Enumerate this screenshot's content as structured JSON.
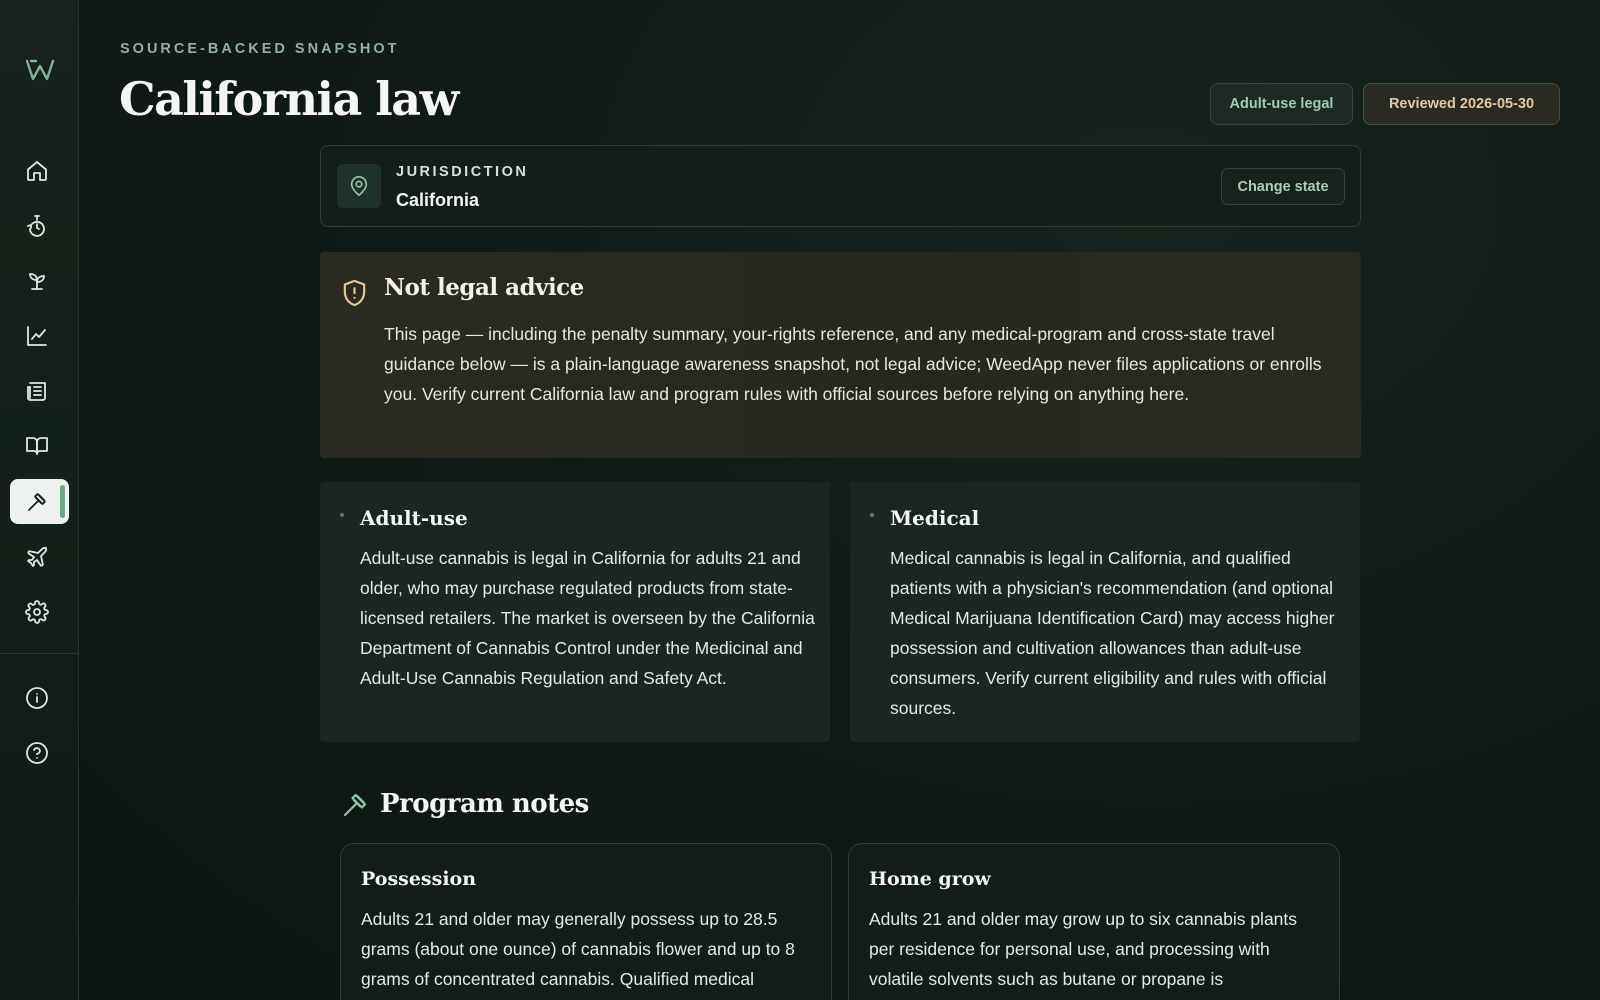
{
  "header": {
    "eyebrow": "SOURCE-BACKED SNAPSHOT",
    "title": "California law",
    "badges": {
      "status": "Adult-use legal",
      "reviewed": "Reviewed 2026-05-30"
    }
  },
  "sidebar": {
    "logo_icon": "weedapp-logo-icon",
    "items": [
      {
        "icon": "home-icon"
      },
      {
        "icon": "session-timer-icon"
      },
      {
        "icon": "sprout-icon"
      },
      {
        "icon": "chart-line-icon"
      },
      {
        "icon": "newspaper-icon"
      },
      {
        "icon": "book-open-icon"
      },
      {
        "icon": "gavel-icon",
        "active": true
      },
      {
        "icon": "plane-icon"
      },
      {
        "icon": "gear-icon"
      }
    ],
    "footer_items": [
      {
        "icon": "info-icon"
      },
      {
        "icon": "help-icon"
      }
    ]
  },
  "jurisdiction": {
    "label": "JURISDICTION",
    "value": "California",
    "change_label": "Change state",
    "icon": "map-pin-icon"
  },
  "disclaimer": {
    "icon": "shield-alert-icon",
    "title": "Not legal advice",
    "text": "This page — including the penalty summary, your-rights reference, and any medical-program and cross-state travel guidance below — is a plain-language awareness snapshot, not legal advice; WeedApp never files applications or enrolls you. Verify current California law and program rules with official sources before relying on anything here."
  },
  "status_cards": [
    {
      "title": "Adult-use",
      "text": "Adult-use cannabis is legal in California for adults 21 and older, who may purchase regulated products from state-licensed retailers. The market is overseen by the California Department of Cannabis Control under the Medicinal and Adult-Use Cannabis Regulation and Safety Act."
    },
    {
      "title": "Medical",
      "text": "Medical cannabis is legal in California, and qualified patients with a physician's recommendation (and optional Medical Marijuana Identification Card) may access higher possession and cultivation allowances than adult-use consumers. Verify current eligibility and rules with official sources."
    }
  ],
  "program_notes": {
    "title": "Program notes",
    "icon": "gavel-icon",
    "cards": [
      {
        "title": "Possession",
        "text": "Adults 21 and older may generally possess up to 28.5 grams (about one ounce) of cannabis flower and up to 8 grams of concentrated cannabis. Qualified medical"
      },
      {
        "title": "Home grow",
        "text": "Adults 21 and older may grow up to six cannabis plants per residence for personal use, and processing with volatile solvents such as butane or propane is"
      }
    ]
  },
  "colors": {
    "background": "#0f1713",
    "accent": "#8fc3a4",
    "warning": "#e4c79b"
  }
}
